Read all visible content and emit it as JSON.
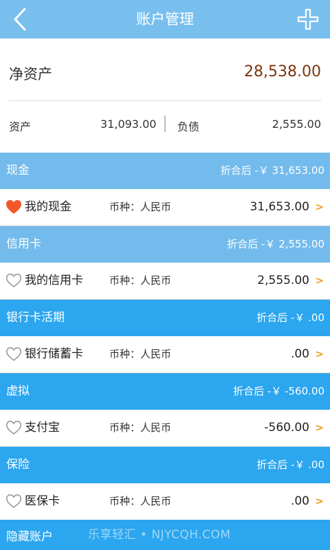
{
  "header": {
    "title": "账户管理",
    "back_icon": "chevron-left-icon",
    "add_icon": "plus-icon"
  },
  "summary": {
    "net_label": "净资产",
    "net_value": "28,538.00",
    "asset_label": "资产",
    "asset_value": "31,093.00",
    "debt_label": "负债",
    "debt_value": "2,555.00"
  },
  "groups": [
    {
      "name": "现金",
      "total": "折合后 -￥ 31,653.00",
      "color": "#73bbec",
      "account": {
        "name": "我的现金",
        "currency": "币种：人民币",
        "balance": "31,653.00",
        "favorite": true
      }
    },
    {
      "name": "信用卡",
      "total": "折合后 -￥ 2,555.00",
      "color": "#73bbec",
      "account": {
        "name": "我的信用卡",
        "currency": "币种：人民币",
        "balance": "2,555.00",
        "favorite": false
      }
    },
    {
      "name": "银行卡活期",
      "total": "折合后 -￥ .00",
      "color": "#2ba6ef",
      "account": {
        "name": "银行储蓄卡",
        "currency": "币种：人民币",
        "balance": ".00",
        "favorite": false
      }
    },
    {
      "name": "虚拟",
      "total": "折合后 -￥ -560.00",
      "color": "#2ba6ef",
      "account": {
        "name": "支付宝",
        "currency": "币种：人民币",
        "balance": "-560.00",
        "favorite": false
      }
    },
    {
      "name": "保险",
      "total": "折合后 -￥ .00",
      "color": "#2ba6ef",
      "account": {
        "name": "医保卡",
        "currency": "币种：人民币",
        "balance": ".00",
        "favorite": false
      }
    }
  ],
  "chevron": ">",
  "hidden": {
    "label": "隐藏账户",
    "watermark": "乐享轻汇 • NJYCQH.COM"
  },
  "colors": {
    "topbar": "#79bfee",
    "net_value": "#7a3510",
    "favorite_heart": "#f0582a",
    "chevron": "#f29a1c"
  }
}
